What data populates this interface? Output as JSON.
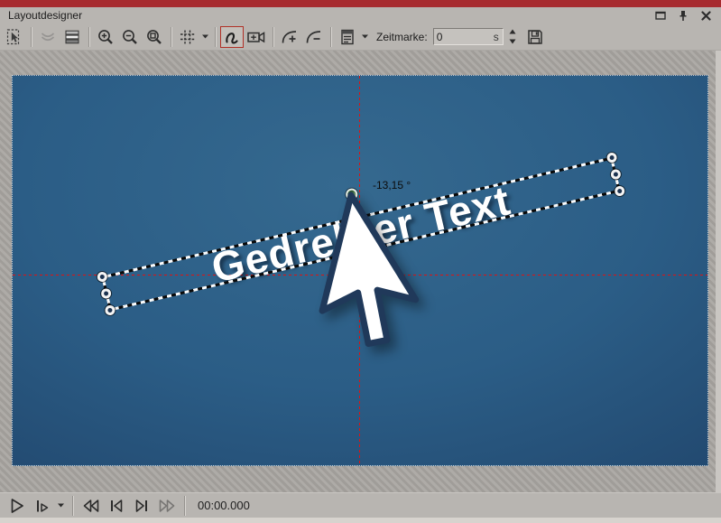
{
  "colors": {
    "accent-red": "#a72b2f",
    "chrome-bg": "#b8b5b1",
    "active-tool-border": "#b03026",
    "crosshair": "#e01212",
    "canvas-center": "#35698f",
    "canvas-edge": "#16304d"
  },
  "window": {
    "title": "Layoutdesigner",
    "buttons": [
      "maximize",
      "pin",
      "close"
    ]
  },
  "toolbar": {
    "icons": [
      "select-tool",
      "smooth-curve",
      "layers",
      "zoom-in",
      "zoom-out",
      "zoom-fit",
      "grid",
      "motion-path",
      "camera",
      "keyframe-add",
      "keyframe-remove",
      "timeline-column",
      "save"
    ],
    "active_tool": "motion-path",
    "zeitmarke": {
      "label": "Zeitmarke:",
      "value": "0",
      "unit": "s"
    }
  },
  "canvas": {
    "object_text": "Gedrehter Text",
    "angle_label": "-13,15 °",
    "rotation_deg": -13.15
  },
  "playbar": {
    "icons": [
      "play",
      "play-from-here",
      "rewind",
      "skip-to-start",
      "skip-to-end",
      "fast-forward"
    ],
    "time": "00:00.000"
  }
}
